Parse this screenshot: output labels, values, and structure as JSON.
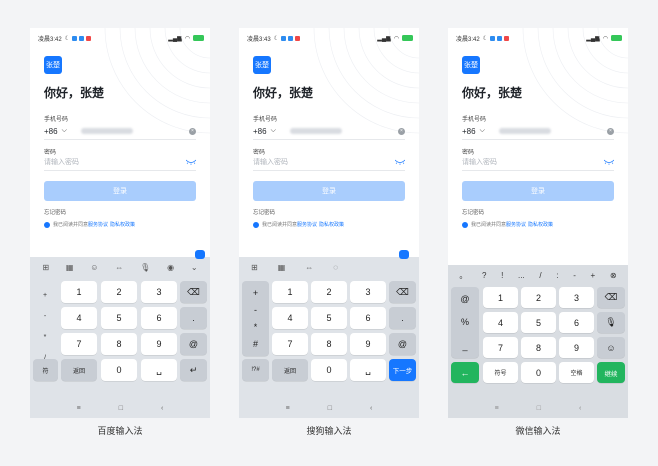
{
  "app": {
    "logo_text": "张楚",
    "greeting": "你好，张楚",
    "phone_label": "手机号码",
    "country_code": "+86",
    "password_label": "密码",
    "password_placeholder": "请输入密码",
    "login_button": "登录",
    "forgot_password": "忘记密码",
    "agree_prefix": "我已阅读并同意",
    "service_agreement": "服务协议",
    "privacy_policy": "隐私权政策"
  },
  "phones": [
    {
      "time": "凌晨3:42",
      "caption": "百度输入法",
      "keyboard": {
        "left_symbols": [
          "+",
          "-",
          "*",
          "/"
        ],
        "digits": [
          "1",
          "2",
          "3",
          "4",
          "5",
          "6",
          "7",
          "8",
          "9",
          "0"
        ],
        "right_symbols": [
          ".",
          "@"
        ],
        "symbol_key": "符",
        "back_key": "返回"
      }
    },
    {
      "time": "凌晨3:43",
      "caption": "搜狗输入法",
      "keyboard": {
        "left_symbols": [
          "+",
          "-",
          "*",
          "#"
        ],
        "digits": [
          "1",
          "2",
          "3",
          "4",
          "5",
          "6",
          "7",
          "8",
          "9",
          "0"
        ],
        "right_symbols": [
          ".",
          "@"
        ],
        "symbol_key": "!?#",
        "back_key": "返回",
        "next_key": "下一步"
      }
    },
    {
      "time": "凌晨3:42",
      "caption": "微信输入法",
      "keyboard": {
        "top_symbols": [
          "。",
          "?",
          "!",
          "...",
          "/",
          ":",
          "-",
          "+"
        ],
        "left_symbols": [
          "@",
          "%",
          "_"
        ],
        "digits": [
          "1",
          "2",
          "3",
          "4",
          "5",
          "6",
          "7",
          "8",
          "9",
          "0"
        ],
        "symbol_key": "符号",
        "space_key": "空格",
        "continue_key": "继续"
      }
    }
  ],
  "colors": {
    "primary": "#1677ff",
    "login_disabled": "#a9cdfd",
    "wechat_green": "#22b55e",
    "keyboard_bg": "#dfe3e8"
  }
}
